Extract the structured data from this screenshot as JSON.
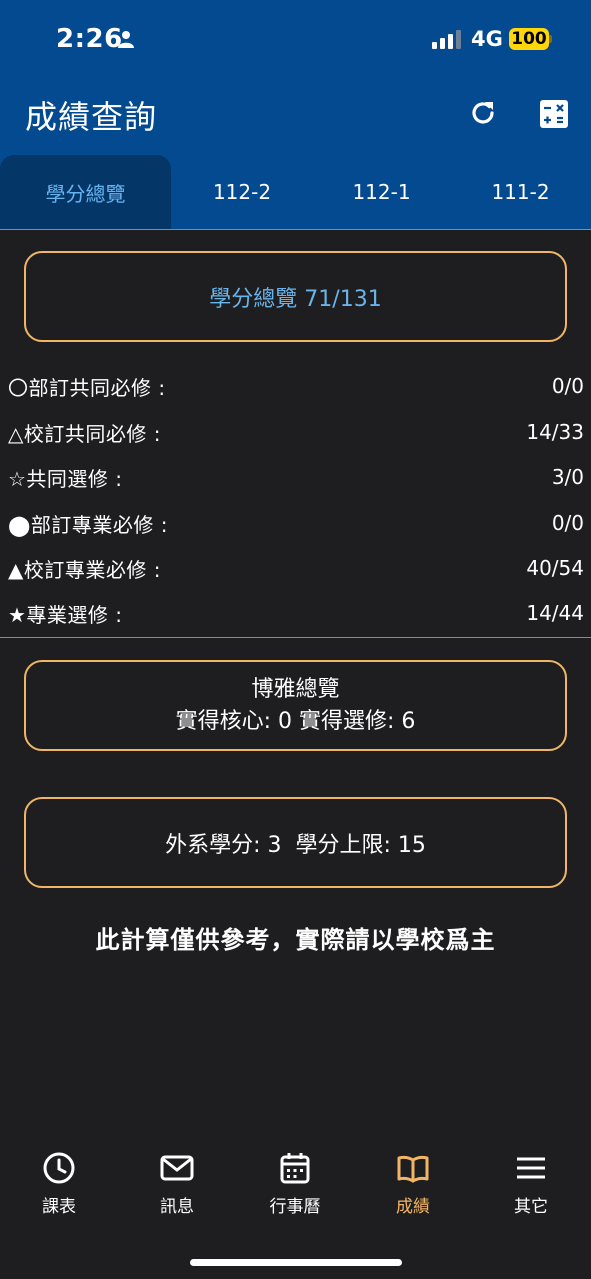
{
  "status_bar": {
    "time": "2:26",
    "network": "4G",
    "battery": "100"
  },
  "header": {
    "title": "成績查詢"
  },
  "tabs": [
    {
      "label": "學分總覽"
    },
    {
      "label": "112-2"
    },
    {
      "label": "112-1"
    },
    {
      "label": "111-2"
    }
  ],
  "credit_summary": {
    "text": "學分總覽 71/131"
  },
  "credit_rows": [
    {
      "label": "〇部訂共同必修 :",
      "value": "0/0"
    },
    {
      "label": "△校訂共同必修 :",
      "value": "14/33"
    },
    {
      "label": "☆共同選修 :",
      "value": "3/0"
    },
    {
      "label": "⬤部訂專業必修 :",
      "value": "0/0"
    },
    {
      "label": "▲校訂專業必修 :",
      "value": "40/54"
    },
    {
      "label": "★專業選修 :",
      "value": "14/44"
    }
  ],
  "general_ed": {
    "title": "博雅總覽",
    "detail": "實得核心: 0 實得選修: 6"
  },
  "outside_dept": {
    "text": "外系學分: 3  學分上限: 15"
  },
  "disclaimer": "此計算僅供參考，實際請以學校爲主",
  "nav": [
    {
      "label": "課表",
      "icon": "clock-icon"
    },
    {
      "label": "訊息",
      "icon": "mail-icon"
    },
    {
      "label": "行事曆",
      "icon": "calendar-icon"
    },
    {
      "label": "成績",
      "icon": "book-icon"
    },
    {
      "label": "其它",
      "icon": "menu-icon"
    }
  ],
  "colors": {
    "header": "#044a90",
    "accent": "#f1b665",
    "active_tab_text": "#67b4ef",
    "background": "#1e1e20"
  }
}
